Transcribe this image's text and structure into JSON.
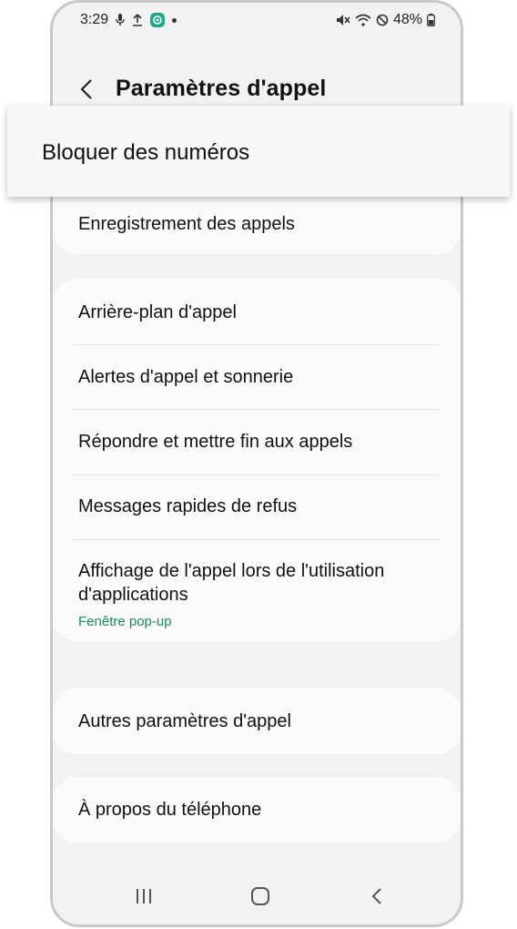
{
  "status_bar": {
    "time": "3:29",
    "battery": "48%",
    "left_icons": [
      "mic-icon",
      "upload-icon",
      "app-notification-icon",
      "dot-icon"
    ],
    "right_icons": [
      "mute-icon",
      "wifi-icon",
      "do-not-disturb-icon",
      "battery-icon"
    ]
  },
  "header": {
    "title": "Paramètres d'appel"
  },
  "popup": {
    "label": "Bloquer des numéros"
  },
  "sections": {
    "card1": {
      "item": "Enregistrement des appels"
    },
    "card2": {
      "items": [
        "Arrière-plan d'appel",
        "Alertes d'appel et sonnerie",
        "Répondre et mettre fin aux appels",
        "Messages rapides de refus"
      ],
      "last_item": {
        "label": "Affichage de l'appel lors de l'utilisation d'applications",
        "subtitle": "Fenêtre pop-up"
      }
    },
    "card3": {
      "item": "Autres paramètres d'appel"
    },
    "card4": {
      "item": "À propos du téléphone"
    }
  },
  "colors": {
    "accent": "#1a8a5a",
    "background": "#f2f2f2",
    "card": "#fbfbfb"
  }
}
